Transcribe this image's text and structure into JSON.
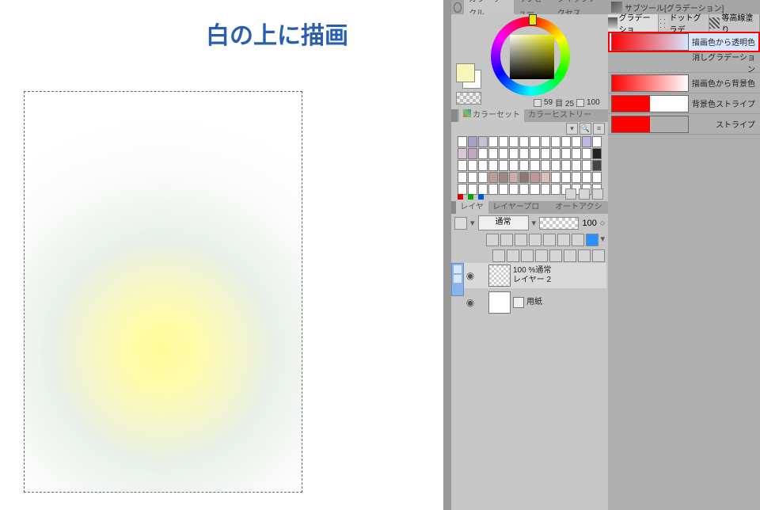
{
  "canvas": {
    "overlay_title": "白の上に描画"
  },
  "color_panel": {
    "tab_circle": "カラーサークル",
    "tab_subview": "サブビュー",
    "tab_quick": "クイックアクセス",
    "h": "59",
    "s": "目 25",
    "v": "100",
    "main_swatch": "#f7f5b8",
    "sub_swatch": "#ffffff"
  },
  "color_set": {
    "tab_set": "カラーセット",
    "tab_history": "カラーヒストリー"
  },
  "layer_panel": {
    "tab_layer": "レイヤー",
    "tab_prop": "レイヤープロパティ",
    "tab_auto": "オートアクション",
    "blend_mode": "通常",
    "opacity": "100",
    "layer1_pct": "100 %通常",
    "layer1_name": "レイヤー 2",
    "layer2_name": "用紙"
  },
  "subtool": {
    "header": "サブツール[グラデーション]",
    "tab1": "グラデーショ",
    "tab2": "ドットグラデ",
    "tab3": "等高線塗り",
    "items": [
      {
        "name": "描画色から透明色",
        "css": "linear-gradient(to right,#ff0000,rgba(255,0,0,0))",
        "selected": true
      },
      {
        "name": "消しグラデーション",
        "css": "none"
      },
      {
        "name": "描画色から背景色",
        "css": "linear-gradient(to right,#ff0000,#ffffff)"
      },
      {
        "name": "背景色ストライプ",
        "css": "linear-gradient(to right,#ff0000 50%,#ffffff 50%)"
      },
      {
        "name": "ストライプ",
        "css": "linear-gradient(to right,#ff0000 50%,rgba(255,0,0,0) 50%)"
      }
    ]
  }
}
